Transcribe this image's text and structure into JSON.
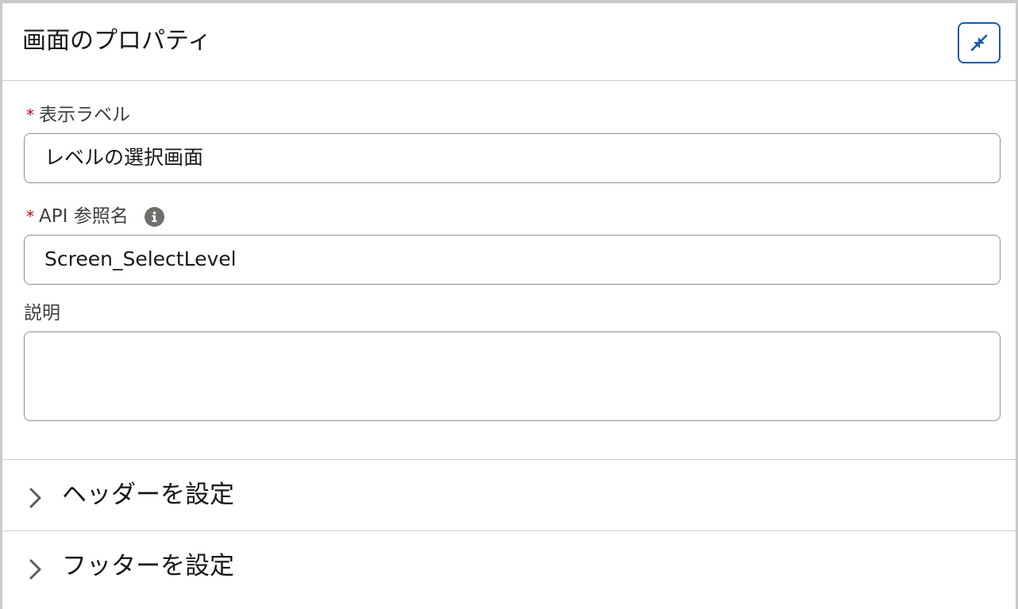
{
  "panel": {
    "title": "画面のプロパティ",
    "collapse_icon": "collapse-arrows-icon"
  },
  "fields": {
    "display_label": {
      "required_mark": "*",
      "label": "表示ラベル",
      "value": "レベルの選択画面"
    },
    "api_name": {
      "required_mark": "*",
      "label": "API 参照名",
      "info_icon": "info-icon",
      "value": "Screen_SelectLevel"
    },
    "description": {
      "label": "説明",
      "value": ""
    }
  },
  "sections": [
    {
      "label": "ヘッダーを設定",
      "icon": "chevron-right-icon"
    },
    {
      "label": "フッターを設定",
      "icon": "chevron-right-icon"
    }
  ],
  "colors": {
    "accent": "#1b5aa6",
    "required": "#ba0517",
    "border": "#c9c9c9"
  }
}
